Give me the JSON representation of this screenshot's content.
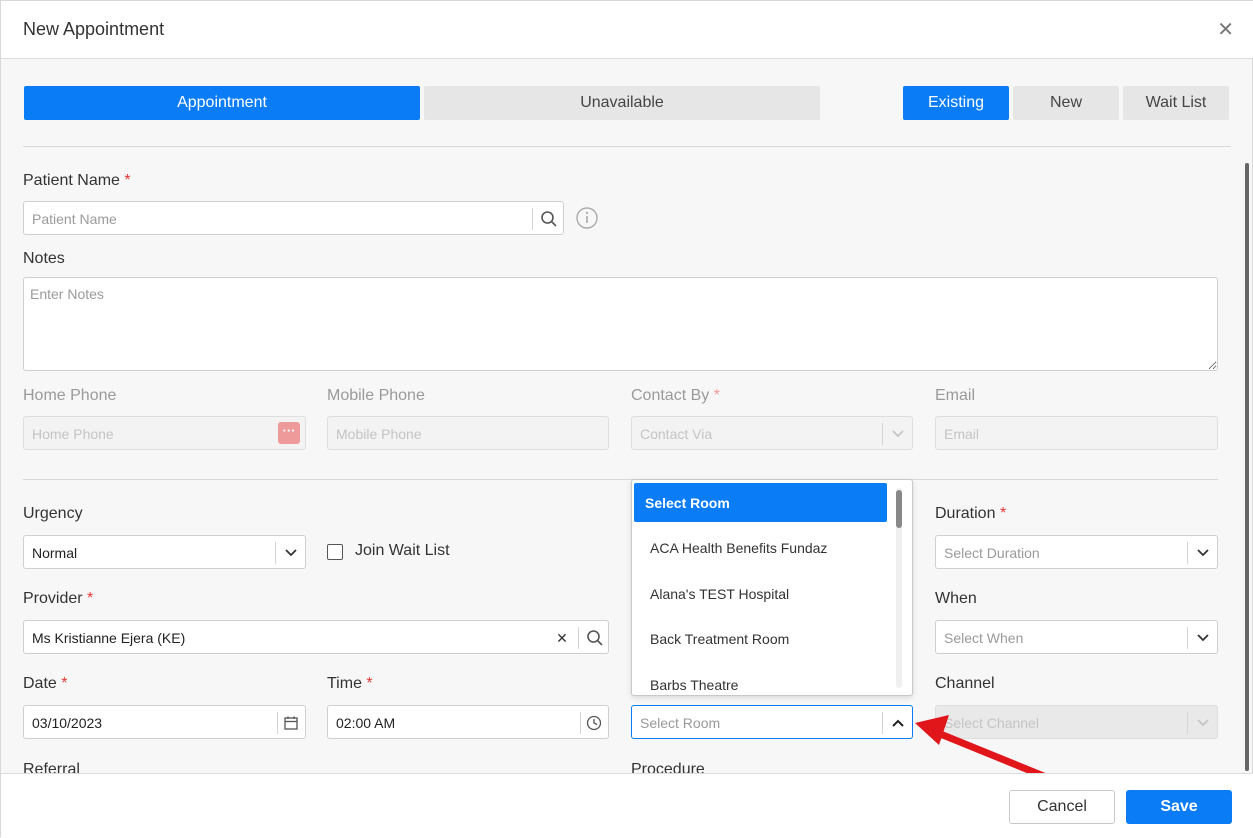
{
  "dialog": {
    "title": "New Appointment"
  },
  "modes": {
    "appointment": "Appointment",
    "unavailable": "Unavailable"
  },
  "patient_type": {
    "existing": "Existing",
    "new": "New",
    "wait_list": "Wait List"
  },
  "patient_name": {
    "label": "Patient Name",
    "placeholder": "Patient Name"
  },
  "notes": {
    "label": "Notes",
    "placeholder": "Enter Notes"
  },
  "home_phone": {
    "label": "Home Phone",
    "placeholder": "Home Phone"
  },
  "mobile_phone": {
    "label": "Mobile Phone",
    "placeholder": "Mobile Phone"
  },
  "contact_by": {
    "label": "Contact By",
    "placeholder": "Contact Via"
  },
  "email": {
    "label": "Email",
    "placeholder": "Email"
  },
  "urgency": {
    "label": "Urgency",
    "value": "Normal"
  },
  "join_wait_list": {
    "label": "Join Wait List",
    "checked": false
  },
  "duration": {
    "label": "Duration",
    "placeholder": "Select Duration"
  },
  "provider": {
    "label": "Provider",
    "value": "Ms Kristianne Ejera (KE)"
  },
  "when": {
    "label": "When",
    "placeholder": "Select When"
  },
  "date": {
    "label": "Date",
    "value": "03/10/2023"
  },
  "time": {
    "label": "Time",
    "value": "02:00 AM"
  },
  "room": {
    "placeholder": "Select Room",
    "options": [
      "Select Room",
      "ACA Health Benefits Fundaz",
      "Alana's TEST Hospital",
      "Back Treatment Room",
      "Barbs Theatre"
    ]
  },
  "channel": {
    "label": "Channel",
    "placeholder": "Select Channel"
  },
  "referral": {
    "label": "Referral"
  },
  "procedure": {
    "label": "Procedure"
  },
  "required_marker": "*",
  "footer": {
    "cancel": "Cancel",
    "save": "Save"
  },
  "colors": {
    "primary": "#0a7cf5",
    "required": "#e53935",
    "annotation_arrow": "#e0161b"
  }
}
